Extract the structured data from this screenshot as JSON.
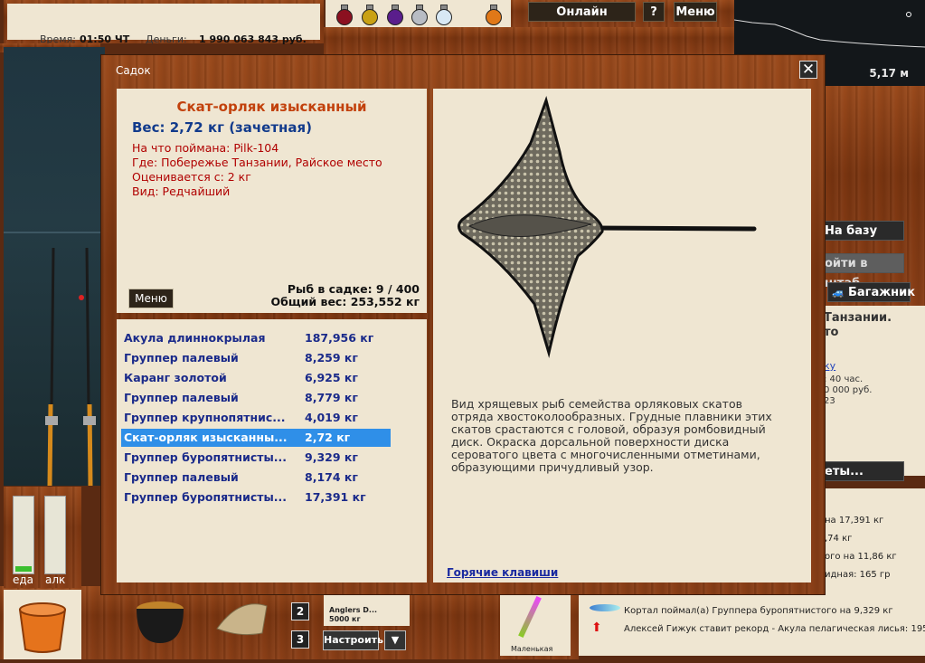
{
  "status": {
    "time_label": "Время:",
    "time_value": "01:50 ЧТ",
    "money_label": "Деньги:",
    "money_value": "1 990 063 843 руб."
  },
  "topbar": {
    "online_services": "Онлайн сервисы",
    "help": "?",
    "menu": "Меню"
  },
  "map": {
    "depth": "5,17 м"
  },
  "dialog": {
    "title": "Садок",
    "close": "✕",
    "fish": {
      "name": "Скат-орляк изысканный",
      "weight_line": "Вес: 2,72 кг (зачетная)",
      "caught_with": "На что поймана: Pilk-104",
      "where": "Где: Побережье Танзании, Райское место",
      "rated_from": "Оценивается с: 2 кг",
      "kind": "Вид: Редчайший"
    },
    "menu_button": "Меню",
    "fish_in_keepnet": "Рыб в садке: 9 / 400",
    "total_weight": "Общий вес: 253,552 кг",
    "catch_list": [
      {
        "name": "Акула длиннокрылая",
        "weight": "187,956 кг",
        "selected": false
      },
      {
        "name": "Группер палевый",
        "weight": "8,259 кг",
        "selected": false
      },
      {
        "name": "Каранг золотой",
        "weight": "6,925 кг",
        "selected": false
      },
      {
        "name": "Группер палевый",
        "weight": "8,779 кг",
        "selected": false
      },
      {
        "name": "Группер крупнопятнис...",
        "weight": "4,019 кг",
        "selected": false
      },
      {
        "name": "Скат-орляк изысканны...",
        "weight": "2,72 кг",
        "selected": true
      },
      {
        "name": "Группер буропятнисты...",
        "weight": "9,329 кг",
        "selected": false
      },
      {
        "name": "Группер палевый",
        "weight": "8,174 кг",
        "selected": false
      },
      {
        "name": "Группер буропятнисты...",
        "weight": "17,391 кг",
        "selected": false
      }
    ],
    "description": "Вид хрящевых рыб семейства орляковых скатов отряда хвостоколообразных. Грудные плавники этих скатов срастаются с головой, образуя ромбовидный диск. Окраска дорсальной поверхности диска сероватого цвета с многочисленными отметинами, образующими причудливый узор.",
    "hotkeys": "Горячие клавиши"
  },
  "right_panel": {
    "to_base": "На базу",
    "to_hq": "ойти в штаб",
    "trunk": "Багажник",
    "location_line1": "Танзании.",
    "location_line2": "то",
    "link_text": "ку",
    "info1": ": 40 час.",
    "info2": "0 000 руб.",
    "info3": "23",
    "tickets_btn": "еты...",
    "feed": [
      "на 17,391 кг",
      ",74 кг",
      "ого на 11,86 кг",
      "идная: 165 гр",
      "Кортал поймал(а) Группера буропятнистого на 9,329 кг",
      "Алексей  Гижук ставит рекорд - Акула пелагическая лисья: 195"
    ]
  },
  "bottom": {
    "food_label": "еда",
    "alc_label": "алк",
    "slot2": "2",
    "slot3": "3",
    "tune_button": "Настроить",
    "tune_arrow": "▼",
    "bait_name": "Anglers D...",
    "bait_weight": "5000 кг",
    "lure_label": "Маленькая"
  },
  "colors": {
    "accent_orange": "#c2410c",
    "weight_blue": "#123b8c",
    "info_red": "#b00000",
    "list_blue": "#1a2a8a",
    "selection": "#2f8fe8",
    "paper": "#efe6d2"
  }
}
